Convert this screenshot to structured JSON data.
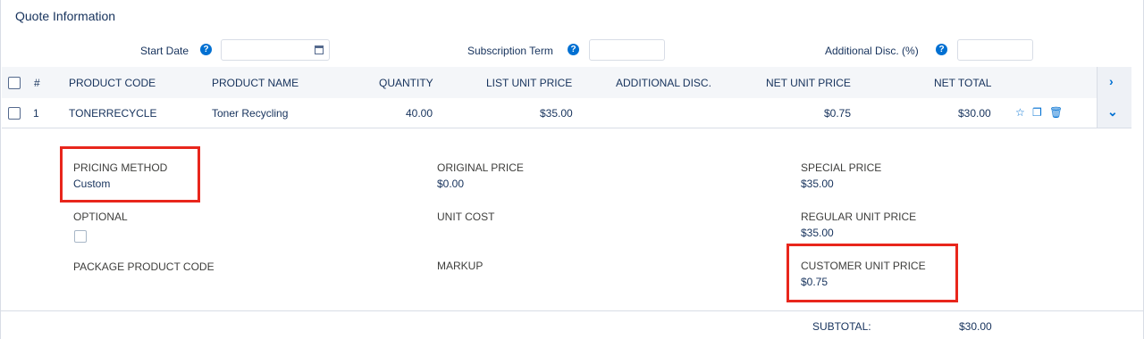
{
  "section": {
    "title": "Quote Information"
  },
  "filters": {
    "start_date": {
      "label": "Start Date",
      "value": ""
    },
    "subscription_term": {
      "label": "Subscription Term",
      "value": ""
    },
    "additional_disc": {
      "label": "Additional Disc. (%)",
      "value": ""
    },
    "help_glyph": "?"
  },
  "table": {
    "headers": [
      "#",
      "PRODUCT CODE",
      "PRODUCT NAME",
      "QUANTITY",
      "LIST UNIT PRICE",
      "ADDITIONAL DISC.",
      "NET UNIT PRICE",
      "NET TOTAL"
    ],
    "rows": [
      {
        "num": "1",
        "product_code": "TONERRECYCLE",
        "product_name": "Toner Recycling",
        "quantity": "40.00",
        "list_unit_price": "$35.00",
        "additional_disc": "",
        "net_unit_price": "$0.75",
        "net_total": "$30.00"
      }
    ]
  },
  "details": {
    "pricing_method": {
      "label": "PRICING METHOD",
      "value": "Custom"
    },
    "original_price": {
      "label": "ORIGINAL PRICE",
      "value": "$0.00"
    },
    "special_price": {
      "label": "SPECIAL PRICE",
      "value": "$35.00"
    },
    "optional": {
      "label": "OPTIONAL"
    },
    "unit_cost": {
      "label": "UNIT COST",
      "value": ""
    },
    "regular_unit_price": {
      "label": "REGULAR UNIT PRICE",
      "value": "$35.00"
    },
    "package_product_code": {
      "label": "PACKAGE PRODUCT CODE",
      "value": ""
    },
    "markup": {
      "label": "MARKUP",
      "value": ""
    },
    "customer_unit_price": {
      "label": "CUSTOMER UNIT PRICE",
      "value": "$0.75"
    }
  },
  "footer": {
    "subtotal_label": "SUBTOTAL:",
    "subtotal_value": "$30.00"
  },
  "colors": {
    "accent": "#0070d2",
    "highlight": "#e8261c",
    "header_bg": "#f4f6f9"
  },
  "icons": {
    "row_actions": [
      "star-icon",
      "clone-icon",
      "delete-icon"
    ],
    "header_nav": "chevron-right-icon",
    "row_toggle": "chevron-down-icon"
  }
}
